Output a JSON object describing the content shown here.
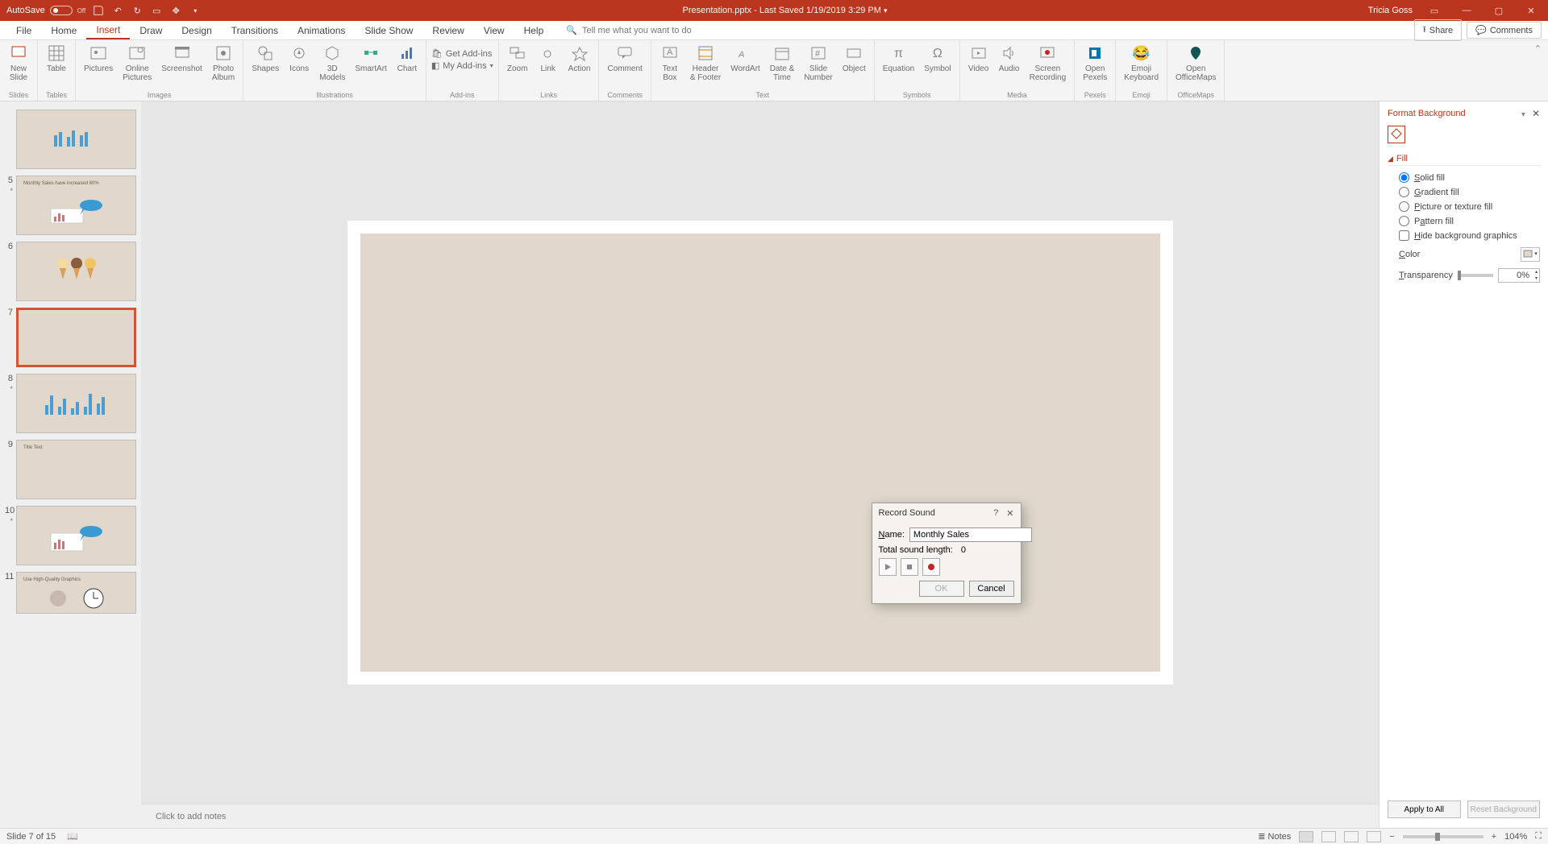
{
  "titlebar": {
    "autosave_label": "AutoSave",
    "autosave_state": "Off",
    "doc_title": "Presentation.pptx  -  Last Saved 1/19/2019 3:29 PM",
    "user": "Tricia Goss"
  },
  "tabs": [
    "File",
    "Home",
    "Insert",
    "Draw",
    "Design",
    "Transitions",
    "Animations",
    "Slide Show",
    "Review",
    "View",
    "Help"
  ],
  "active_tab": "Insert",
  "search_placeholder": "Tell me what you want to do",
  "share": "Share",
  "comments": "Comments",
  "ribbon": {
    "slides": {
      "new_slide": "New\nSlide",
      "label": "Slides"
    },
    "tables": {
      "table": "Table",
      "label": "Tables"
    },
    "images": {
      "pictures": "Pictures",
      "online": "Online\nPictures",
      "screenshot": "Screenshot",
      "album": "Photo\nAlbum",
      "label": "Images"
    },
    "illus": {
      "shapes": "Shapes",
      "icons": "Icons",
      "models": "3D\nModels",
      "sa": "SmartArt",
      "chart": "Chart",
      "label": "Illustrations"
    },
    "addins": {
      "get": "Get Add-ins",
      "my": "My Add-ins",
      "label": "Add-ins"
    },
    "links": {
      "zoom": "Zoom",
      "link": "Link",
      "action": "Action",
      "label": "Links"
    },
    "comments_grp": {
      "comment": "Comment",
      "label": "Comments"
    },
    "text": {
      "tbox": "Text\nBox",
      "hf": "Header\n& Footer",
      "wa": "WordArt",
      "dt": "Date &\nTime",
      "sn": "Slide\nNumber",
      "obj": "Object",
      "label": "Text"
    },
    "symbols": {
      "eq": "Equation",
      "sym": "Symbol",
      "label": "Symbols"
    },
    "media": {
      "video": "Video",
      "audio": "Audio",
      "rec": "Screen\nRecording",
      "label": "Media"
    },
    "pexels": {
      "btn": "Open\nPexels",
      "label": "Pexels"
    },
    "emoji": {
      "btn": "Emoji\nKeyboard",
      "label": "Emoji"
    },
    "office": {
      "btn": "Open\nOfficeMaps",
      "label": "OfficeMaps"
    }
  },
  "thumbs": [
    {
      "n": "",
      "sel": false,
      "kind": "bars"
    },
    {
      "n": "5",
      "sel": false,
      "kind": "callout",
      "title": "Monthly Sales have increased 60%"
    },
    {
      "n": "6",
      "sel": false,
      "kind": "cones"
    },
    {
      "n": "7",
      "sel": true,
      "kind": "blank"
    },
    {
      "n": "8",
      "sel": false,
      "kind": "bars"
    },
    {
      "n": "9",
      "sel": false,
      "kind": "text",
      "title": "Title Text"
    },
    {
      "n": "10",
      "sel": false,
      "kind": "callout"
    },
    {
      "n": "11",
      "sel": false,
      "kind": "clock",
      "title": "Use High-Quality Graphics"
    }
  ],
  "notes_placeholder": "Click to add notes",
  "dialog": {
    "title": "Record Sound",
    "name_label": "Name:",
    "name_value": "Monthly Sales",
    "len_label": "Total sound length:",
    "len_value": "0",
    "ok": "OK",
    "cancel": "Cancel"
  },
  "panel": {
    "title": "Format Background",
    "fill": "Fill",
    "solid": "Solid fill",
    "grad": "Gradient fill",
    "pic": "Picture or texture fill",
    "pat": "Pattern fill",
    "hide": "Hide background graphics",
    "color": "Color",
    "trans": "Transparency",
    "trans_val": "0%",
    "apply": "Apply to All",
    "reset": "Reset Background"
  },
  "status": {
    "left": "Slide 7 of 15",
    "notes": "Notes",
    "zoom": "104%"
  }
}
